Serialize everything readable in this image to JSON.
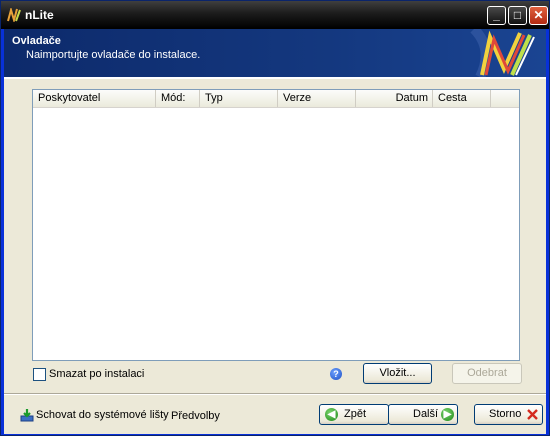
{
  "window": {
    "title": "nLite"
  },
  "header": {
    "title": "Ovladače",
    "subtitle": "Naimportujte ovladače do instalace."
  },
  "list": {
    "columns": [
      "Poskytovatel",
      "Mód:",
      "Typ",
      "Verze",
      "Datum",
      "Cesta"
    ],
    "rows": []
  },
  "options": {
    "delete_after_install": {
      "label": "Smazat po instalaci",
      "checked": false
    }
  },
  "buttons": {
    "insert": "Vložit...",
    "remove": "Odebrat",
    "back": "Zpět",
    "next": "Další",
    "cancel": "Storno"
  },
  "footer": {
    "tray": "Schovat do systémové lišty",
    "preferences": "Předvolby"
  },
  "colors": {
    "titlebar": "#1b1b1b",
    "header": "#14387f",
    "face": "#ece9d8"
  }
}
